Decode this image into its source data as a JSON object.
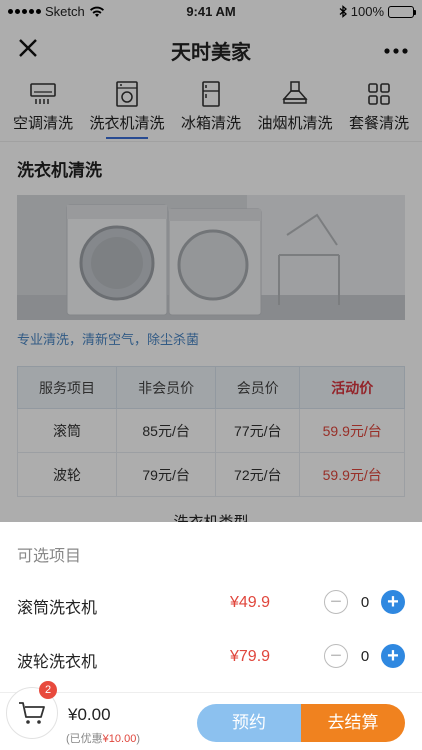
{
  "status_bar": {
    "carrier": "Sketch",
    "time": "9:41 AM",
    "battery": "100%"
  },
  "nav": {
    "title": "天时美家"
  },
  "tabs": [
    {
      "label": "空调清洗",
      "icon": "air-conditioner-icon"
    },
    {
      "label": "洗衣机清洗",
      "icon": "washing-machine-icon",
      "active": true
    },
    {
      "label": "冰箱清洗",
      "icon": "refrigerator-icon"
    },
    {
      "label": "油烟机清洗",
      "icon": "range-hood-icon"
    },
    {
      "label": "套餐清洗",
      "icon": "grid-icon"
    }
  ],
  "section": {
    "title": "洗衣机清洗",
    "desc": "专业清洗，清新空气，除尘杀菌",
    "type_title": "洗衣机类型"
  },
  "price_table": {
    "headers": [
      "服务项目",
      "非会员价",
      "会员价",
      "活动价"
    ],
    "rows": [
      [
        "滚筒",
        "85元/台",
        "77元/台",
        "59.9元/台"
      ],
      [
        "波轮",
        "79元/台",
        "72元/台",
        "59.9元/台"
      ]
    ]
  },
  "sheet": {
    "title": "可选项目",
    "options": [
      {
        "name": "滚筒洗衣机",
        "price": "¥49.9",
        "qty": "0"
      },
      {
        "name": "波轮洗衣机",
        "price": "¥79.9",
        "qty": "0"
      }
    ]
  },
  "footer": {
    "badge": "2",
    "total": "¥0.00",
    "saved_prefix": "(已优惠",
    "saved_amount": "¥10.00",
    "saved_suffix": ")",
    "reserve_label": "预约",
    "checkout_label": "去结算"
  },
  "colors": {
    "accent_blue": "#2f88e0",
    "accent_orange": "#f0821f",
    "price_red": "#e0463c"
  }
}
